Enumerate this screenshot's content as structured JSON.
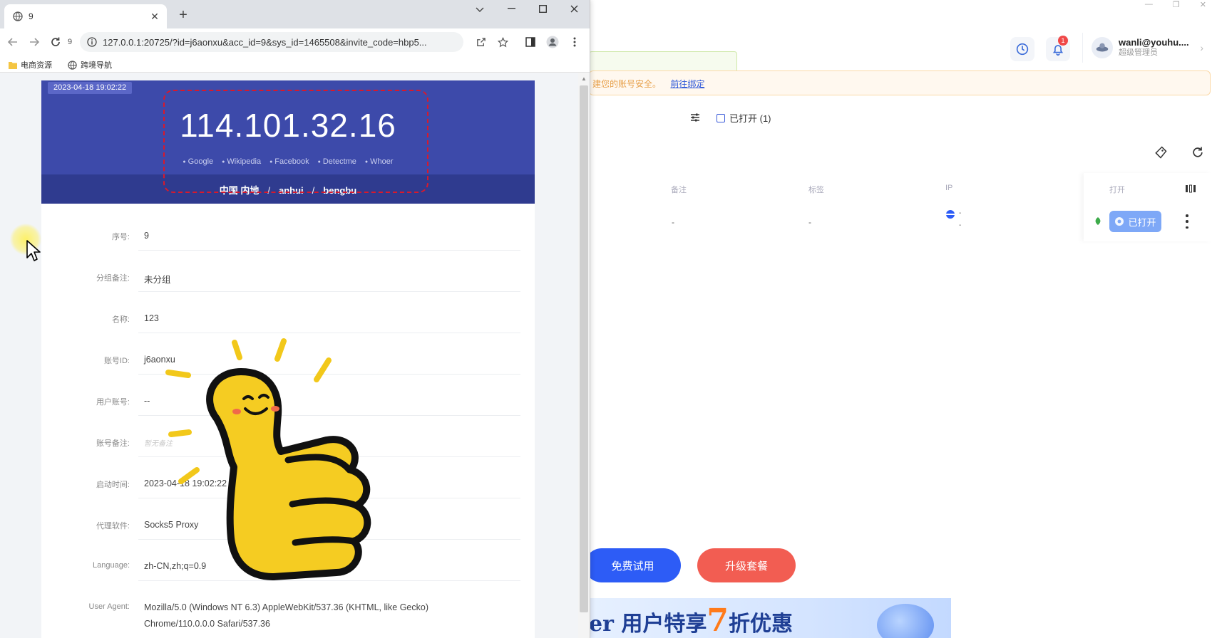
{
  "app": {
    "user_name": "wanli@youhu....",
    "user_role": "超级管理员",
    "notification_count": "1",
    "warning_text": "建您的账号安全。",
    "warning_link": "前往绑定",
    "opened_filter": "已打开 (1)",
    "table_headers": {
      "remark": "备注",
      "tag": "标签",
      "ip": "IP",
      "open": "打开"
    },
    "row": {
      "remark": "-",
      "tag": "-",
      "ip_sub": "-",
      "ip_sub2": "-",
      "status_btn": "已打开"
    },
    "btn_trial": "免费试用",
    "btn_upgrade": "升级套餐",
    "promo": {
      "prefix": "er 用户特享",
      "num": "7",
      "suffix": "折优惠"
    }
  },
  "chrome": {
    "tab_title": "9",
    "tab_count": "9",
    "url": "127.0.0.1:20725/?id=j6aonxu&acc_id=9&sys_id=1465508&invite_code=hbp5...",
    "bookmarks": [
      "电商资源",
      "跨境导航"
    ]
  },
  "page": {
    "date_chip": "2023-04-18 19:02:22",
    "ip": "114.101.32.16",
    "sites": [
      "Google",
      "Wikipedia",
      "Facebook",
      "Detectme",
      "Whoer"
    ],
    "location": [
      "中国 内地",
      "anhui",
      "bengbu"
    ],
    "rows": [
      {
        "label": "序号:",
        "value": "9"
      },
      {
        "label": "分组备注:",
        "value": "未分组"
      },
      {
        "label": "名称:",
        "value": "123"
      },
      {
        "label": "账号ID:",
        "value": "j6aonxu"
      },
      {
        "label": "用户账号:",
        "value": "--"
      },
      {
        "label": "账号备注:",
        "value": "暂无备注"
      },
      {
        "label": "启动时间:",
        "value": "2023-04-18 19:02:22"
      },
      {
        "label": "代理软件:",
        "value": "Socks5 Proxy"
      },
      {
        "label": "Language:",
        "value": "zh-CN,zh;q=0.9"
      },
      {
        "label": "User Agent:",
        "value": "Mozilla/5.0 (Windows NT 6.3) AppleWebKit/537.36 (KHTML, like Gecko)",
        "value2": "Chrome/110.0.0.0 Safari/537.36"
      }
    ]
  },
  "colors": {
    "accent": "#3d4aaa",
    "dashed_border": "#d8192c",
    "trial": "#2d5cf6",
    "upgrade": "#f25d52"
  }
}
